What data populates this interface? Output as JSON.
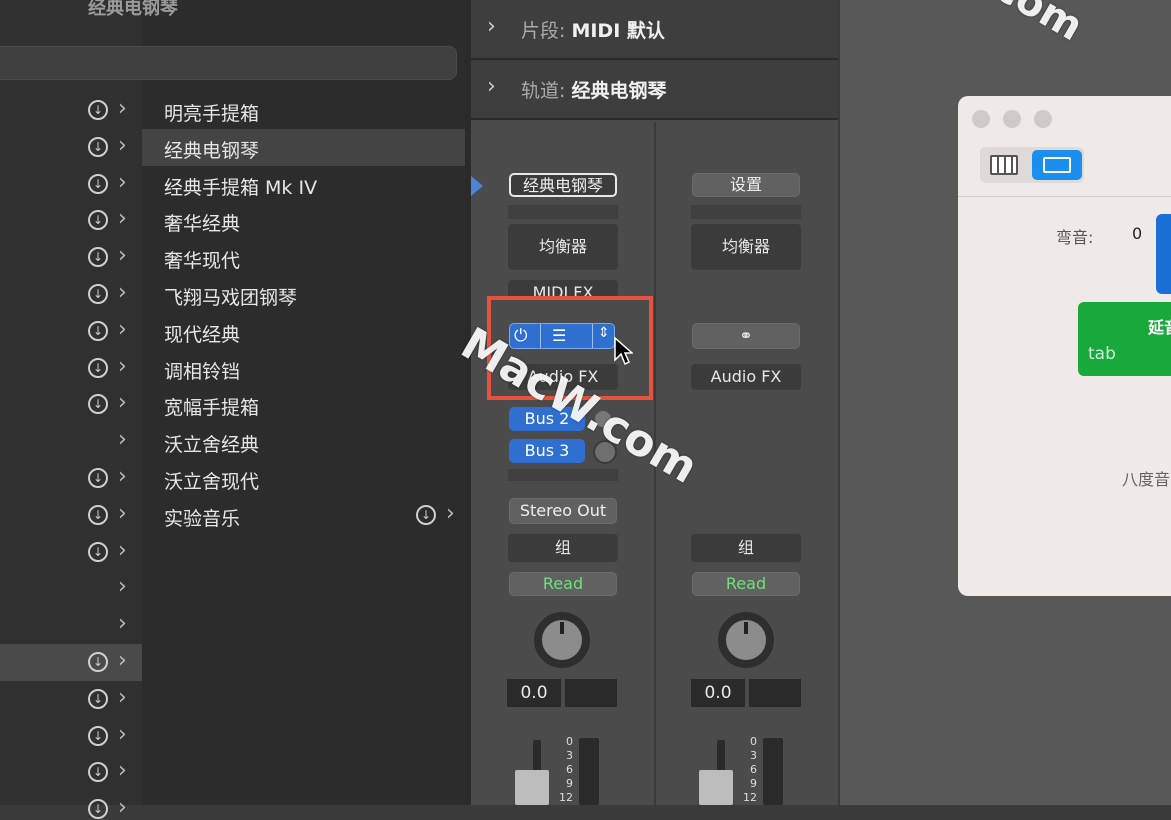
{
  "library": {
    "title": "经典电钢琴",
    "items": [
      {
        "label": "明亮手提箱",
        "selected": false
      },
      {
        "label": "经典电钢琴",
        "selected": true
      },
      {
        "label": "经典手提箱 Mk IV",
        "selected": false
      },
      {
        "label": "奢华经典",
        "selected": false
      },
      {
        "label": "奢华现代",
        "selected": false
      },
      {
        "label": "飞翔马戏团钢琴",
        "selected": false
      },
      {
        "label": "现代经典",
        "selected": false
      },
      {
        "label": "调相铃铛",
        "selected": false
      },
      {
        "label": "宽幅手提箱",
        "selected": false
      },
      {
        "label": "沃立舍经典",
        "selected": false
      },
      {
        "label": "沃立舍现代",
        "selected": false
      },
      {
        "label": "实验音乐",
        "selected": false
      }
    ]
  },
  "inspector": {
    "region_label": "片段:",
    "region_value": "MIDI 默认",
    "track_label": "轨道:",
    "track_value": "经典电钢琴"
  },
  "channel1": {
    "name": "经典电钢琴",
    "eq": "均衡器",
    "midi_fx": "MIDI FX",
    "audio_fx": "Audio FX",
    "sends": [
      "Bus 2",
      "Bus 3"
    ],
    "output": "Stereo Out",
    "group": "组",
    "automation": "Read",
    "volume": "0.0"
  },
  "channel2": {
    "name": "设置",
    "eq": "均衡器",
    "audio_fx": "Audio FX",
    "group": "组",
    "automation": "Read",
    "volume": "0.0"
  },
  "meter_ticks": [
    "0",
    "3",
    "6",
    "9",
    "12"
  ],
  "keyboard_window": {
    "pitch_label": "弯音:",
    "pitch_value": "0",
    "sustain_label": "延音",
    "tab_hint": "tab",
    "octave_label": "八度音"
  },
  "watermarks": [
    "MacW.com",
    "com"
  ],
  "colors": {
    "highlight": "#e5533d",
    "blue": "#2f6fd0",
    "read": "#6fe07a",
    "green": "#19a83c"
  }
}
